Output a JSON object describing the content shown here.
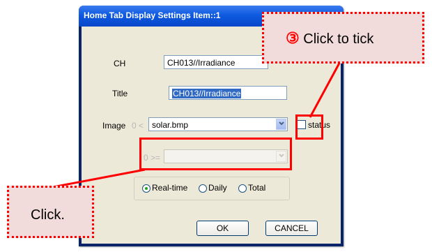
{
  "window": {
    "title": "Home Tab Display Settings Item::1"
  },
  "form": {
    "ch_label": "CH",
    "ch_value": "CH013//Irradiance",
    "title_label": "Title",
    "title_value": "CH013//Irradiance",
    "image_label": "Image",
    "image_lower": "0 <",
    "image_value": "solar.bmp",
    "status_label": "status",
    "status_checked": false,
    "second_lower": "0 >=",
    "second_value": ""
  },
  "mode": {
    "options": [
      "Real-time",
      "Daily",
      "Total"
    ],
    "selected": "Real-time"
  },
  "buttons": {
    "ok": "OK",
    "cancel": "CANCEL"
  },
  "annotations": {
    "step_number": "③",
    "step_text": "Click to tick",
    "click_text": "Click."
  },
  "colors": {
    "annotation": "#ff0000",
    "callout_fill": "#f2dcdb",
    "title_bar": "#0846c9"
  }
}
